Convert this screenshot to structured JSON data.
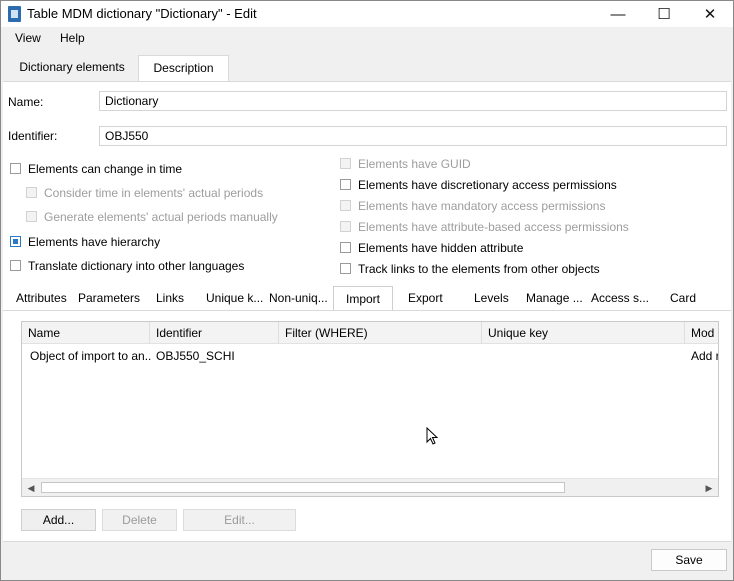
{
  "window": {
    "title": "Table MDM dictionary \"Dictionary\" - Edit",
    "minimize": "—",
    "maximize": "☐",
    "close": "✕"
  },
  "menu": {
    "items": [
      "View",
      "Help"
    ]
  },
  "top_tabs": {
    "items": [
      "Dictionary elements",
      "Description"
    ],
    "active": "Description"
  },
  "form": {
    "name_label": "Name:",
    "name_value": "Dictionary",
    "identifier_label": "Identifier:",
    "identifier_value": "OBJ550"
  },
  "options_left": [
    {
      "label": "Elements can change in time",
      "checked": false,
      "disabled": false
    },
    {
      "label": "Consider time in elements' actual periods",
      "checked": false,
      "disabled": true
    },
    {
      "label": "Generate elements' actual periods manually",
      "checked": false,
      "disabled": true
    },
    {
      "label": "Elements have hierarchy",
      "checked": true,
      "disabled": false
    },
    {
      "label": "Translate dictionary into other languages",
      "checked": false,
      "disabled": false
    }
  ],
  "options_right": [
    {
      "label": "Elements have GUID",
      "checked": false,
      "disabled": true
    },
    {
      "label": "Elements have discretionary access permissions",
      "checked": false,
      "disabled": false
    },
    {
      "label": "Elements have mandatory access permissions",
      "checked": false,
      "disabled": true
    },
    {
      "label": "Elements have attribute-based access permissions",
      "checked": false,
      "disabled": true
    },
    {
      "label": "Elements have hidden attribute",
      "checked": false,
      "disabled": false
    },
    {
      "label": "Track links to the elements from other objects",
      "checked": false,
      "disabled": false
    }
  ],
  "sub_tabs": {
    "items": [
      "Attributes",
      "Parameters",
      "Links",
      "Unique k...",
      "Non-uniq...",
      "Import",
      "Export",
      "Levels",
      "Manage ...",
      "Access s...",
      "Card"
    ],
    "active": "Import"
  },
  "grid": {
    "columns": [
      "Name",
      "Identifier",
      "Filter (WHERE)",
      "Unique key",
      "Mod"
    ],
    "rows": [
      [
        "Object of import to an...",
        "OBJ550_SCHI",
        "",
        "",
        "Add r"
      ]
    ]
  },
  "buttons": {
    "add": "Add...",
    "delete": "Delete",
    "edit": "Edit...",
    "save": "Save"
  },
  "colors": {
    "accent": "#2b79c2",
    "disabled_text": "#9d9d9d"
  },
  "icons": {
    "app": "dictionary-app-icon",
    "cursor": "mouse-pointer-icon"
  }
}
